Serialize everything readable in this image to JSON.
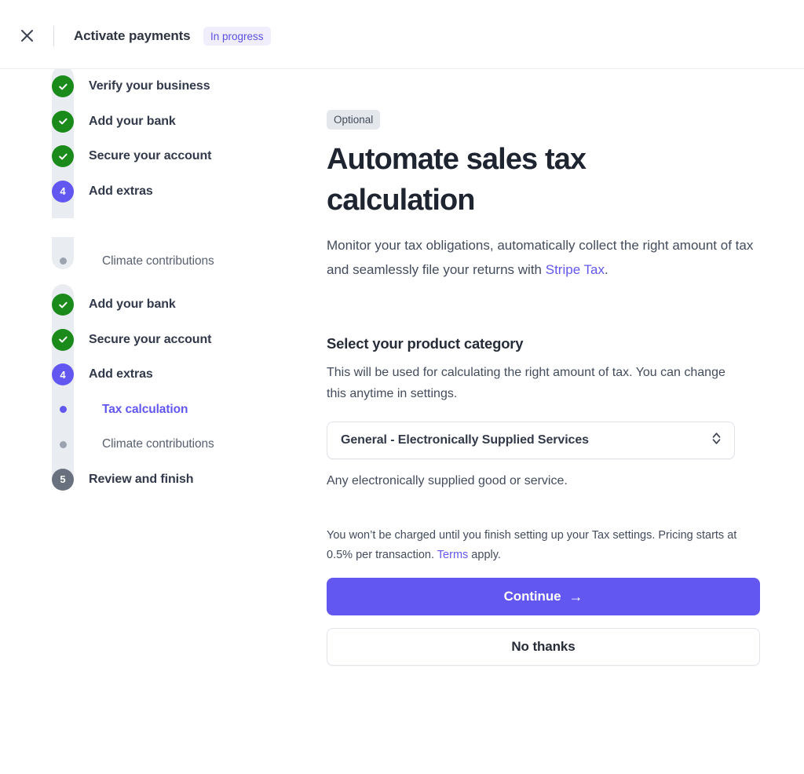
{
  "header": {
    "close_icon": "close-icon",
    "title": "Activate payments",
    "status_badge": "In progress"
  },
  "sidebar": {
    "steps": [
      {
        "marker": "check",
        "number": "",
        "label": "Verify your business",
        "state": "done",
        "type": "step"
      },
      {
        "marker": "check",
        "number": "",
        "label": "Add your bank",
        "state": "done",
        "type": "step"
      },
      {
        "marker": "check",
        "number": "",
        "label": "Secure your account",
        "state": "done",
        "type": "step"
      },
      {
        "marker": "number",
        "number": "4",
        "label": "Add extras",
        "state": "active",
        "type": "step"
      },
      {
        "marker": "dot",
        "number": "",
        "label": "Tax calculation",
        "state": "active",
        "type": "substep"
      },
      {
        "marker": "dot",
        "number": "",
        "label": "Climate contributions",
        "state": "muted",
        "type": "substep"
      },
      {
        "marker": "number",
        "number": "5",
        "label": "Review and finish",
        "state": "todo",
        "type": "step"
      }
    ]
  },
  "main": {
    "optional_badge": "Optional",
    "title": "Automate sales tax calculation",
    "lead_before": "Monitor your tax obligations, automatically collect the right amount of tax and seamlessly file your returns with ",
    "lead_link": "Stripe Tax",
    "lead_after": ".",
    "section_title": "Select your product category",
    "section_desc": "This will be used for calculating the right amount of tax. You can change this anytime in settings.",
    "select_value": "General - Electronically Supplied Services",
    "select_icon": "chevron-up-down-icon",
    "select_help": "Any electronically supplied good or service.",
    "fineprint_before": "You won’t be charged until you finish setting up your Tax settings. Pricing starts at 0.5% per transaction. ",
    "fineprint_link": "Terms",
    "fineprint_after": " apply.",
    "continue_label": "Continue",
    "continue_icon": "arrow-right-icon",
    "no_thanks_label": "No thanks"
  },
  "colors": {
    "accent_purple": "#6257f0",
    "success_green": "#1a8a1a",
    "todo_gray": "#69707e",
    "track_gray": "#e9ecf0",
    "badge_lavender": "#f0edfd",
    "badge_gray": "#e4e7eb"
  }
}
